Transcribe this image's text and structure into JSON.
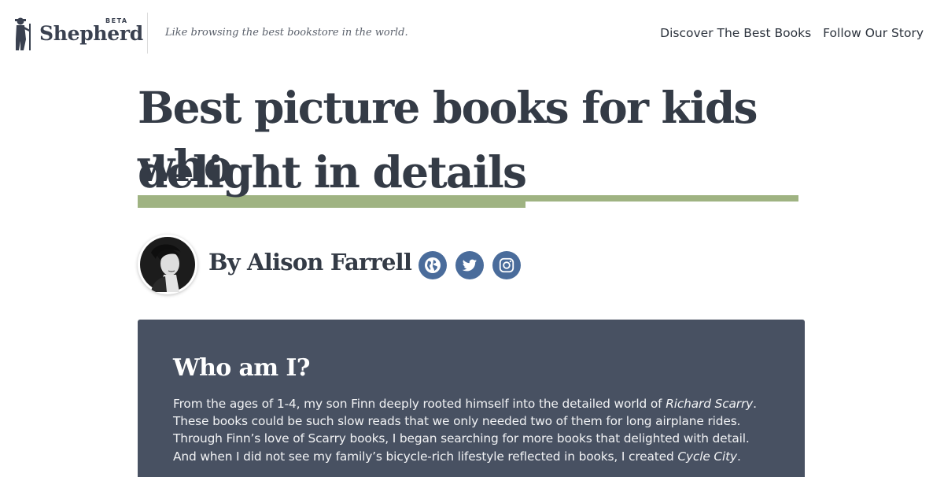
{
  "header": {
    "logo_word": "Shepherd",
    "logo_badge": "BETA",
    "tagline": "Like browsing the best bookstore in the world.",
    "nav": [
      {
        "label": "Discover The Best Books"
      },
      {
        "label": "Follow Our Story"
      }
    ]
  },
  "article": {
    "title_line_1": "Best picture books for kids who",
    "title_line_2": "delight in details",
    "author": "By Alison Farrell",
    "socials": [
      {
        "icon": "globe-icon"
      },
      {
        "icon": "twitter-icon"
      },
      {
        "icon": "instagram-icon"
      }
    ]
  },
  "card": {
    "heading": "Who am I?",
    "p1": "From the ages of 1-4, my son Finn deeply rooted himself into the detailed world of ",
    "p1_em": "Richard Scarry",
    "p2": ". These books could be such slow reads that we only needed two of them for long airplane rides. Through Finn’s love of Scarry books, I began searching for more books that delighted with detail. And when I did not see my family’s bicycle-rich lifestyle reflected in books, I created ",
    "p2_em": "Cycle City",
    "p3": "."
  },
  "colors": {
    "underline": "#9fb382",
    "card_bg": "#485162",
    "social_bg": "#4a6c9b",
    "text_dark": "#343b46"
  }
}
